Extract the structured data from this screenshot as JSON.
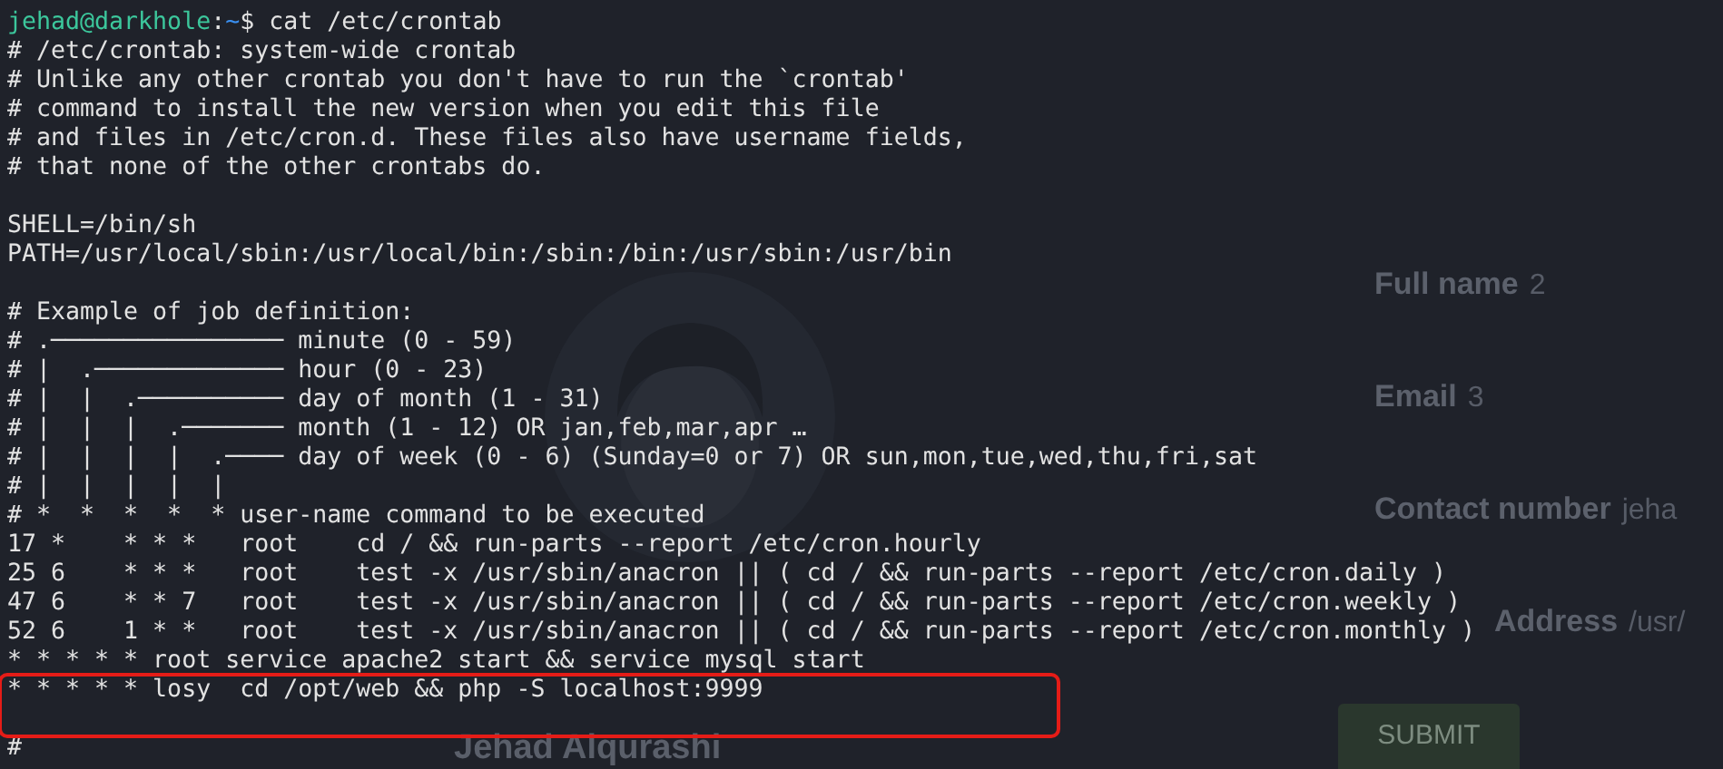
{
  "background_page": {
    "fields": [
      {
        "label": "Full name",
        "value": "2"
      },
      {
        "label": "Email",
        "value": "3"
      },
      {
        "label": "Contact number",
        "value": "jeha"
      },
      {
        "label": "Address",
        "value": "/usr/"
      }
    ],
    "name": "Jehad Alqurashi",
    "submit_button": "SUBMIT"
  },
  "terminal": {
    "prompt": {
      "user_host": "jehad@darkhole",
      "separator": ":",
      "path": "~",
      "symbol": "$",
      "command": "cat /etc/crontab"
    },
    "lines": [
      {
        "kind": "text",
        "text": "# /etc/crontab: system-wide crontab",
        "highlighted": false
      },
      {
        "kind": "text",
        "text": "# Unlike any other crontab you don't have to run the `crontab'",
        "highlighted": false
      },
      {
        "kind": "text",
        "text": "# command to install the new version when you edit this file",
        "highlighted": false
      },
      {
        "kind": "text",
        "text": "# and files in /etc/cron.d. These files also have username fields,",
        "highlighted": false
      },
      {
        "kind": "text",
        "text": "# that none of the other crontabs do.",
        "highlighted": false
      },
      {
        "kind": "blank",
        "highlighted": false
      },
      {
        "kind": "text",
        "text": "SHELL=/bin/sh",
        "highlighted": false
      },
      {
        "kind": "text",
        "text": "PATH=/usr/local/sbin:/usr/local/bin:/sbin:/bin:/usr/sbin:/usr/bin",
        "highlighted": false
      },
      {
        "kind": "blank",
        "highlighted": false
      },
      {
        "kind": "text",
        "text": "# Example of job definition:",
        "highlighted": false
      },
      {
        "kind": "text",
        "text": "# .──────────────── minute (0 - 59)",
        "highlighted": false
      },
      {
        "kind": "text",
        "text": "# |  .───────────── hour (0 - 23)",
        "highlighted": false
      },
      {
        "kind": "text",
        "text": "# |  |  .────────── day of month (1 - 31)",
        "highlighted": false
      },
      {
        "kind": "text",
        "text": "# |  |  |  .─────── month (1 - 12) OR jan,feb,mar,apr …",
        "highlighted": false
      },
      {
        "kind": "text",
        "text": "# |  |  |  |  .──── day of week (0 - 6) (Sunday=0 or 7) OR sun,mon,tue,wed,thu,fri,sat",
        "highlighted": false
      },
      {
        "kind": "text",
        "text": "# |  |  |  |  |",
        "highlighted": false
      },
      {
        "kind": "text",
        "text": "# *  *  *  *  * user-name command to be executed",
        "highlighted": false
      },
      {
        "kind": "text",
        "text": "17 *    * * *   root    cd / && run-parts --report /etc/cron.hourly",
        "highlighted": false
      },
      {
        "kind": "text",
        "text": "25 6    * * *   root    test -x /usr/sbin/anacron || ( cd / && run-parts --report /etc/cron.daily )",
        "highlighted": false
      },
      {
        "kind": "text",
        "text": "47 6    * * 7   root    test -x /usr/sbin/anacron || ( cd / && run-parts --report /etc/cron.weekly )",
        "highlighted": false
      },
      {
        "kind": "text",
        "text": "52 6    1 * *   root    test -x /usr/sbin/anacron || ( cd / && run-parts --report /etc/cron.monthly )",
        "highlighted": false
      },
      {
        "kind": "text",
        "text": "* * * * * root service apache2 start && service mysql start",
        "highlighted": false
      },
      {
        "kind": "text",
        "text": "* * * * * losy  cd /opt/web && php -S localhost:9999",
        "highlighted": true
      },
      {
        "kind": "blank",
        "highlighted": true
      },
      {
        "kind": "text",
        "text": "#",
        "highlighted": false
      }
    ]
  }
}
